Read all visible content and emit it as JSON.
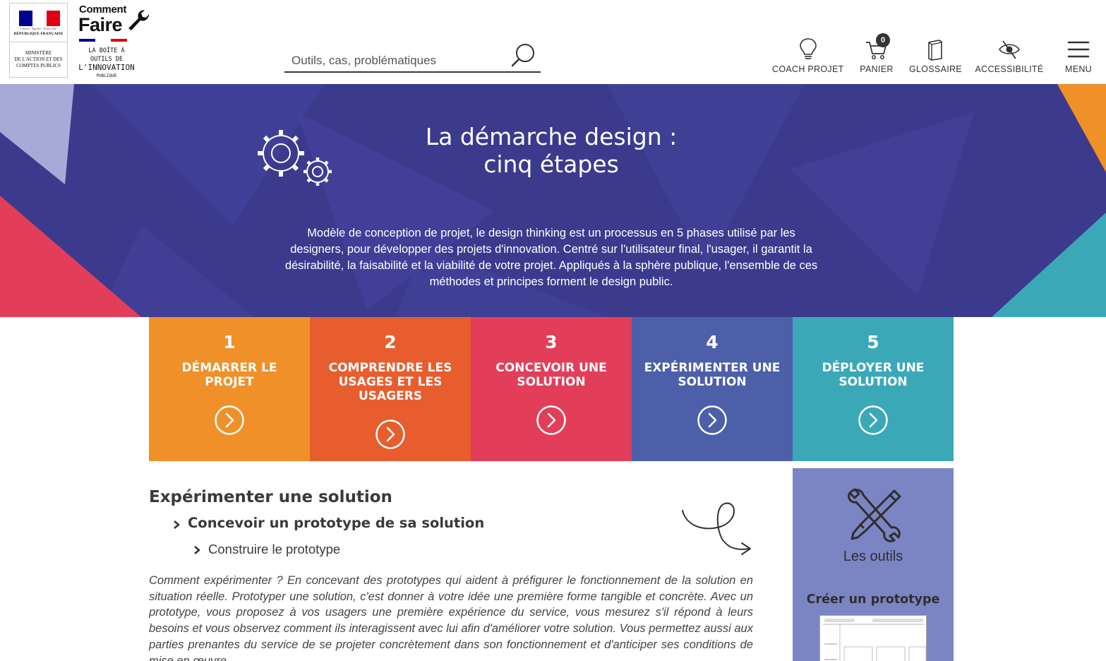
{
  "header": {
    "rf_logo": {
      "motto": "Liberté · Égalité · Fraternité",
      "country": "RÉPUBLIQUE FRANÇAISE",
      "ministry_lines": [
        "MINISTÈRE",
        "DE L'ACTION ET DES",
        "COMPTES PUBLICS"
      ],
      "flag_colors": [
        "#000091",
        "#ffffff",
        "#e1000f"
      ]
    },
    "cf_logo": {
      "word1": "Comment",
      "word2": "Faire",
      "tagline_lines": [
        "LA BOÎTE À OUTILS DE",
        "L'INNOVATION",
        "PUBLIQUE"
      ]
    },
    "search": {
      "placeholder": "Outils, cas, problématiques",
      "value": ""
    },
    "nav": [
      {
        "label": "COACH PROJET",
        "icon": "lightbulb-icon"
      },
      {
        "label": "PANIER",
        "icon": "cart-icon",
        "badge": "0"
      },
      {
        "label": "GLOSSAIRE",
        "icon": "book-icon"
      },
      {
        "label": "ACCESSIBILITÉ",
        "icon": "eye-slash-icon"
      },
      {
        "label": "MENU",
        "icon": "hamburger-icon"
      }
    ]
  },
  "hero": {
    "title_line1": "La démarche design :",
    "title_line2": "cinq étapes",
    "description": "Modèle de conception de projet, le design thinking est un processus en 5 phases utilisé par les designers, pour développer des projets d'innovation. Centré sur l'utilisateur final, l'usager, il garantit la désirabilité, la faisabilité et la viabilité de votre projet. Appliqués à la sphère publique, l'ensemble de ces méthodes et principes forment le design public.",
    "bg_color": "#3c3a8d"
  },
  "steps": [
    {
      "num": "1",
      "title": "Démarrer le projet",
      "color": "#ef9029"
    },
    {
      "num": "2",
      "title": "Comprendre les usages et les usagers",
      "color": "#e85d2e"
    },
    {
      "num": "3",
      "title": "Concevoir une solution",
      "color": "#e23e5a"
    },
    {
      "num": "4",
      "title": "Expérimenter une solution",
      "color": "#4c5fa8"
    },
    {
      "num": "5",
      "title": "Déployer une solution",
      "color": "#3ba8b8"
    }
  ],
  "content": {
    "h1": "Expérimenter une solution",
    "h2": "Concevoir un prototype de sa solution",
    "h3": "Construire le prototype",
    "intro": "Comment expérimenter ? En concevant des prototypes qui aident à préfigurer le fonctionnement de la solution en situation réelle. Prototyper une solution, c'est donner à votre idée une première forme tangible et concrète. Avec un prototype, vous proposez à vos usagers une première expérience du service, vous mesurez s'il répond à leurs besoins et vous observez comment ils interagissent avec lui afin d'améliorer votre solution. Vous permettez aussi aux parties prenantes du service de se projeter concrètement dans son fonctionnement et d'anticiper ses conditions de mise en œuvre."
  },
  "sidebar": {
    "tools_label": "Les outils",
    "resource_title": "Créer un prototype",
    "bg_color": "#7b85c4"
  }
}
